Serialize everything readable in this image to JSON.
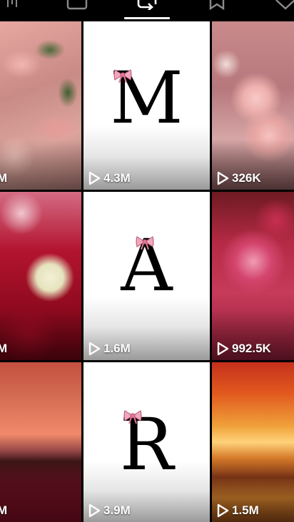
{
  "tabs": [
    {
      "name": "grid-icon"
    },
    {
      "name": "lock-icon"
    },
    {
      "name": "repost-icon",
      "active": true
    },
    {
      "name": "bookmark-icon"
    },
    {
      "name": "liked-icon"
    }
  ],
  "videos": [
    {
      "type": "photo",
      "subject": "pink lilies",
      "views": "M"
    },
    {
      "type": "letter",
      "letter": "M",
      "views": "4.3M"
    },
    {
      "type": "photo",
      "subject": "pink roses",
      "views": "326K"
    },
    {
      "type": "photo",
      "subject": "mixed roses",
      "views": "M"
    },
    {
      "type": "letter",
      "letter": "A",
      "views": "1.6M"
    },
    {
      "type": "photo",
      "subject": "red roses",
      "views": "992.5K"
    },
    {
      "type": "photo",
      "subject": "sunset tulips",
      "views": "M"
    },
    {
      "type": "letter",
      "letter": "R",
      "views": "3.9M"
    },
    {
      "type": "photo",
      "subject": "sunset flower field",
      "views": "1.5M"
    }
  ],
  "colors": {
    "background": "#000000",
    "bow": "#f2a6bd",
    "text": "#ffffff"
  }
}
